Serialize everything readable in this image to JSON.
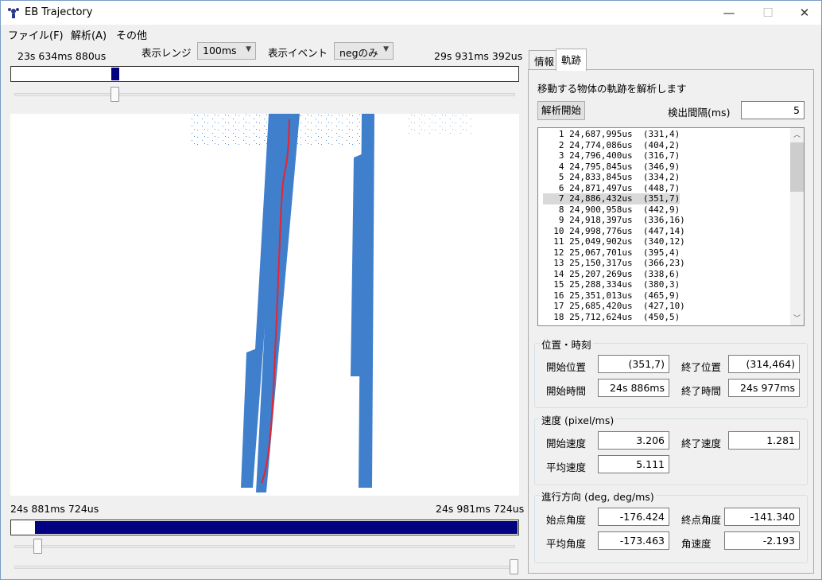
{
  "window": {
    "title": "EB Trajectory",
    "minimize": "—",
    "maximize": "☐",
    "close": "✕"
  },
  "menu": [
    "ファイル(F)",
    "解析(A)",
    "その他"
  ],
  "toolbar": {
    "range_label": "表示レンジ",
    "range_value": "100ms",
    "event_label": "表示イベント",
    "event_value": "negのみ",
    "start_time": "23s 634ms 880us",
    "end_time": "29s 931ms 392us"
  },
  "top_bar": {
    "thumb_position_fraction": 0.2
  },
  "bottom": {
    "start_time": "24s 881ms 724us",
    "end_time": "24s 981ms 724us",
    "fill_start_fraction": 0.05
  },
  "tabs": [
    "情報",
    "軌跡"
  ],
  "panel": {
    "description": "移動する物体の軌跡を解析します",
    "analyze_button": "解析開始",
    "interval_label": "検出間隔(ms)",
    "interval_value": "5",
    "rows": [
      "   1 24,687,995us  (331,4)",
      "   2 24,774,086us  (404,2)",
      "   3 24,796,400us  (316,7)",
      "   4 24,795,845us  (346,9)",
      "   5 24,833,845us  (334,2)",
      "   6 24,871,497us  (448,7)",
      "   7 24,886,432us  (351,7)",
      "   8 24,900,958us  (442,9)",
      "   9 24,918,397us  (336,16)",
      "  10 24,998,776us  (447,14)",
      "  11 25,049,902us  (340,12)",
      "  12 25,067,701us  (395,4)",
      "  13 25,150,317us  (366,23)",
      "  14 25,207,269us  (338,6)",
      "  15 25,288,334us  (380,3)",
      "  16 25,351,013us  (465,9)",
      "  17 25,685,420us  (427,10)",
      "  18 25,712,624us  (450,5)"
    ],
    "selected_index": 6
  },
  "position_group": {
    "title": "位置・時刻",
    "start_pos_label": "開始位置",
    "start_pos": "(351,7)",
    "end_pos_label": "終了位置",
    "end_pos": "(314,464)",
    "start_time_label": "開始時間",
    "start_time": "24s 886ms",
    "end_time_label": "終了時間",
    "end_time": "24s 977ms"
  },
  "speed_group": {
    "title": "速度 (pixel/ms)",
    "start_label": "開始速度",
    "start": "3.206",
    "end_label": "終了速度",
    "end": "1.281",
    "avg_label": "平均速度",
    "avg": "5.111"
  },
  "direction_group": {
    "title": "進行方向 (deg, deg/ms)",
    "start_label": "始点角度",
    "start": "-176.424",
    "end_label": "終点角度",
    "end": "-141.340",
    "avg_label": "平均角度",
    "avg": "-173.463",
    "angvel_label": "角速度",
    "angvel": "-2.193"
  },
  "colors": {
    "event": "#3f7fcc",
    "trajectory": "#e8242f",
    "bar_fill": "#000080"
  }
}
